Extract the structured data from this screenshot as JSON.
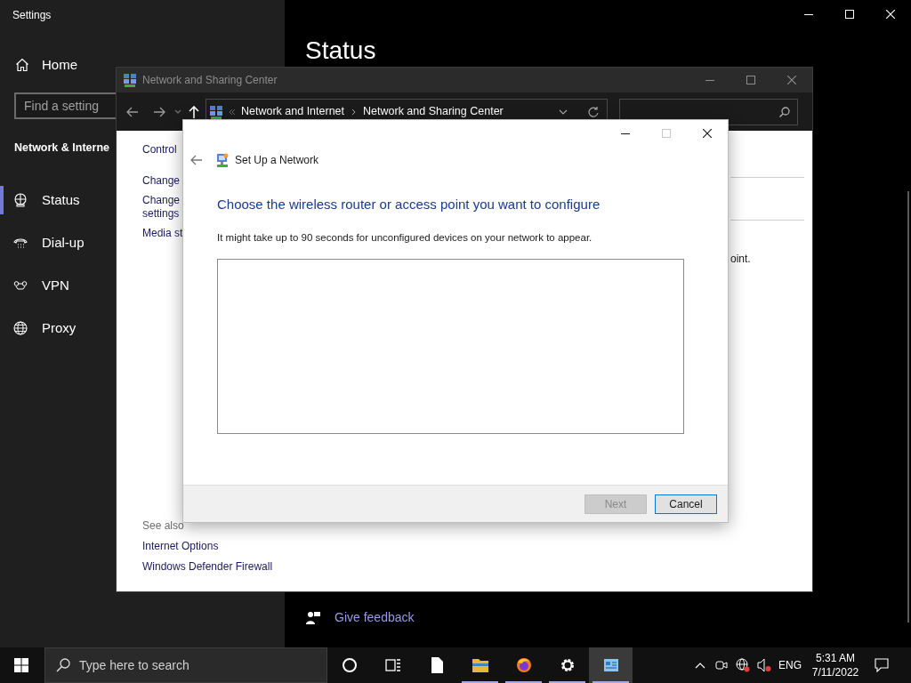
{
  "settings": {
    "title": "Settings",
    "home": "Home",
    "search": {
      "placeholder": "Find a setting"
    },
    "section": "Network & Interne",
    "nav": [
      {
        "kind": "status",
        "label": "Status",
        "selected": true
      },
      {
        "kind": "dialup",
        "label": "Dial-up",
        "selected": false
      },
      {
        "kind": "vpn",
        "label": "VPN",
        "selected": false
      },
      {
        "kind": "proxy",
        "label": "Proxy",
        "selected": false
      }
    ],
    "heading": "Status",
    "feedback": "Give feedback"
  },
  "network_center": {
    "title": "Network and Sharing Center",
    "breadcrumb": [
      "Network and Internet",
      "Network and Sharing Center"
    ],
    "links": [
      {
        "lines": [
          "Control"
        ]
      },
      {
        "lines": [
          "Change"
        ]
      },
      {
        "lines": [
          "Change",
          "settings"
        ]
      },
      {
        "lines": [
          "Media st"
        ]
      }
    ],
    "see_also": {
      "label": "See also",
      "links": [
        "Internet Options",
        "Windows Defender Firewall"
      ]
    },
    "body_fragment": "oint."
  },
  "dialog": {
    "title": "Set Up a Network",
    "heading": "Choose the wireless router or access point you want to configure",
    "description": "It might take up to 90 seconds for unconfigured devices on your network to appear.",
    "buttons": [
      {
        "label": "Next",
        "disabled": true
      },
      {
        "label": "Cancel",
        "disabled": false
      }
    ]
  },
  "taskbar": {
    "search_placeholder": "Type here to search",
    "apps": [
      {
        "kind": "cortana",
        "running": false,
        "selected": false
      },
      {
        "kind": "taskview",
        "running": false,
        "selected": false
      },
      {
        "kind": "file",
        "running": false,
        "selected": false
      },
      {
        "kind": "folder",
        "running": true,
        "selected": false
      },
      {
        "kind": "firefox",
        "running": true,
        "selected": false
      },
      {
        "kind": "gear",
        "running": true,
        "selected": false
      },
      {
        "kind": "control-panel",
        "running": true,
        "selected": true
      }
    ],
    "language": "ENG",
    "time": "5:31 AM",
    "date": "7/11/2022"
  }
}
